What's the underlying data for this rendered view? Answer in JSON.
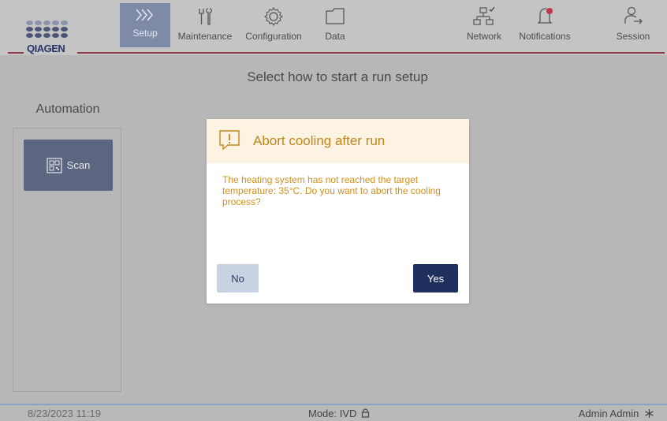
{
  "brand": {
    "logo_text": "QIAGEN"
  },
  "nav": {
    "setup": "Setup",
    "maintenance": "Maintenance",
    "configuration": "Configuration",
    "data": "Data",
    "network": "Network",
    "notifications": "Notifications",
    "session": "Session"
  },
  "main": {
    "headline": "Select how to start a run setup",
    "automation_title": "Automation",
    "scan_label": "Scan"
  },
  "dialog": {
    "title": "Abort cooling after run",
    "message": "The heating system has not reached the target temperature: 35°C. Do you want to abort the cooling process?",
    "no_label": "No",
    "yes_label": "Yes"
  },
  "status": {
    "datetime": "8/23/2023 11:19",
    "mode": "Mode: IVD",
    "user": "Admin Admin"
  },
  "colors": {
    "accent": "#1f2f5e",
    "warning": "#d38f1d",
    "overlay": "#b7b7b7"
  }
}
